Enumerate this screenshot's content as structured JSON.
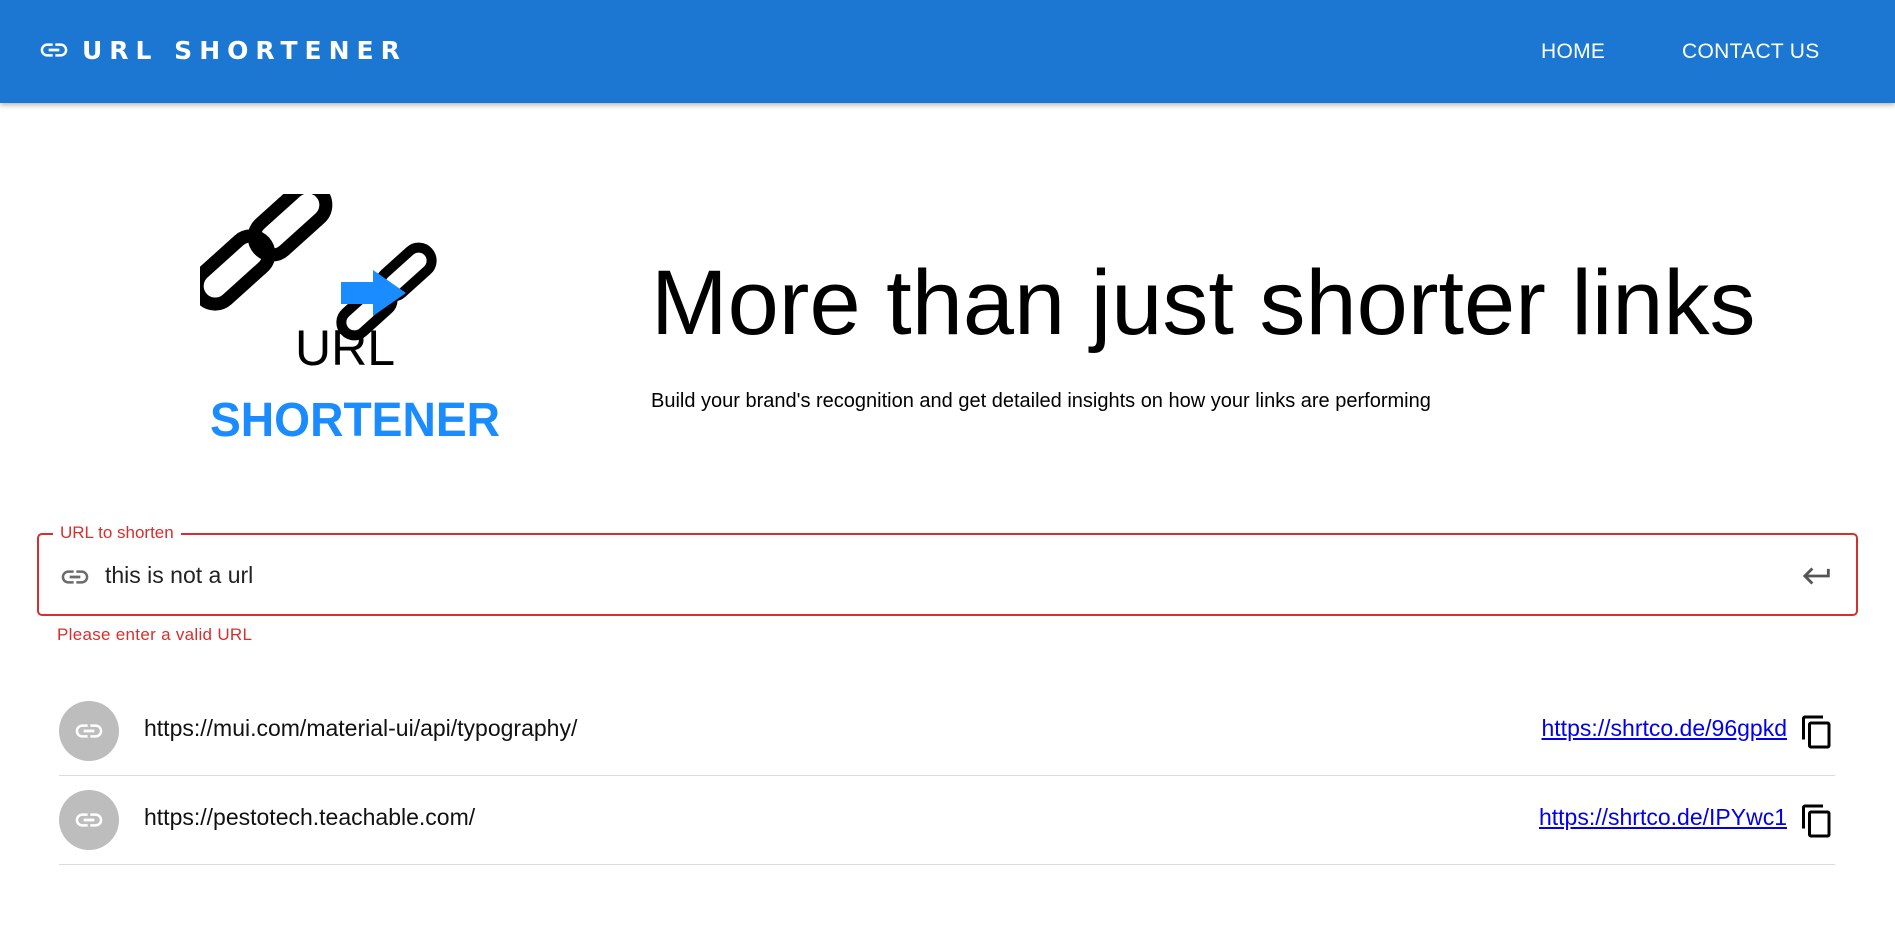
{
  "appbar": {
    "brand": "URL SHORTENER",
    "nav": {
      "home": "HOME",
      "contact": "CONTACT US"
    }
  },
  "logo": {
    "line1": "URL",
    "line2": "SHORTENER"
  },
  "hero": {
    "title": "More than just shorter links",
    "subtitle": "Build your brand's recognition and get detailed insights on how your links are performing"
  },
  "form": {
    "label": "URL to shorten",
    "value": "this is not a url",
    "error": "Please enter a valid URL"
  },
  "links": [
    {
      "original": "https://mui.com/material-ui/api/typography/",
      "short": "https://shrtco.de/96gpkd"
    },
    {
      "original": "https://pestotech.teachable.com/",
      "short": "https://shrtco.de/IPYwc1"
    }
  ],
  "colors": {
    "primary": "#1b77d2",
    "error": "#d3302f",
    "logo_blue": "#1a8cff"
  }
}
